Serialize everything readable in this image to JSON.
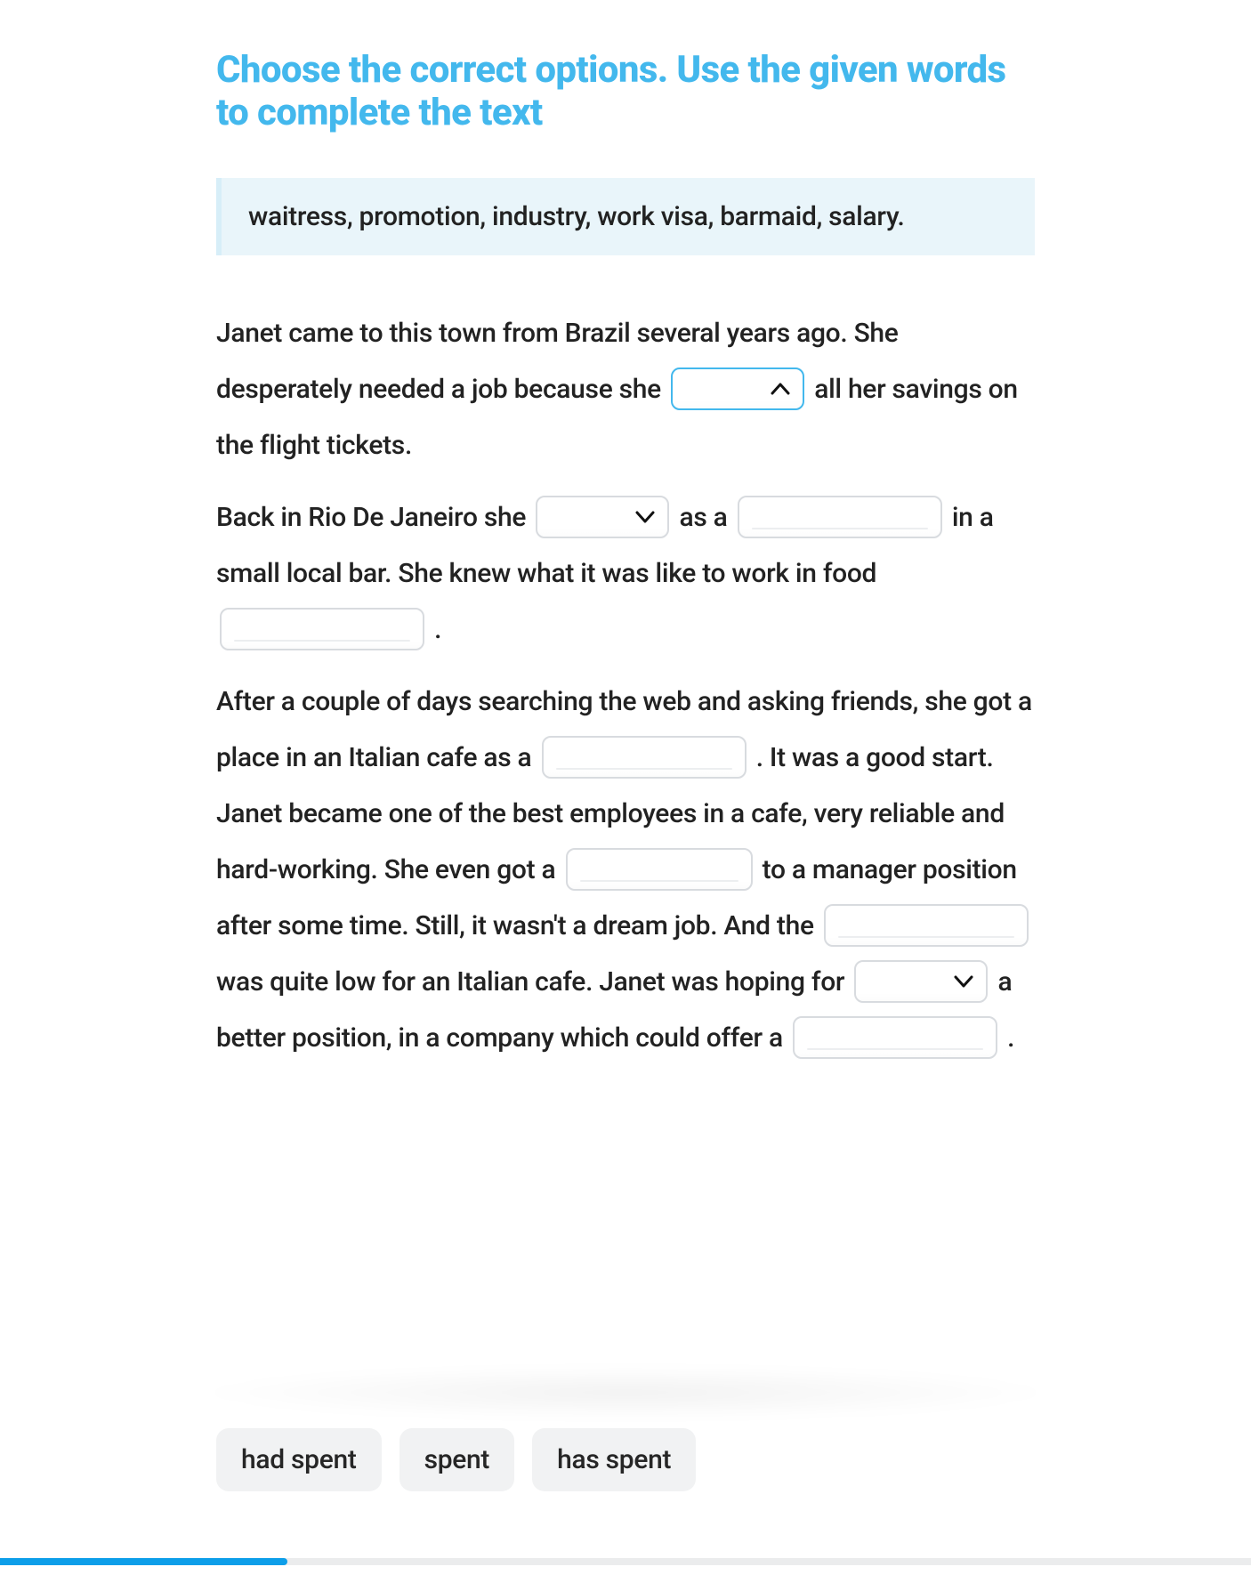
{
  "title": "Choose the correct options. Use the given words to complete the text",
  "wordbank": "waitress, promotion, industry, work visa, barmaid, salary.",
  "passage": {
    "p1a": "Janet came to this town from Brazil several years ago. She desperately needed a job because she ",
    "p1b": " all her savings on the flight tickets.",
    "p2a": "Back in Rio De Janeiro she ",
    "p2b": " as a ",
    "p2c": " in a small local bar. She knew what it was like to work in food ",
    "p2d": " .",
    "p3a": "After a couple of days searching the web and asking friends, she got a place in an Italian cafe as a ",
    "p3b": ". It was a good start. Janet became one of the best employees in a cafe, very reliable and hard-working. She even got a ",
    "p3c": " to a manager position after some time. Still, it wasn't a dream job. And the ",
    "p3d": " was quite low for an Italian cafe. Janet was hoping for ",
    "p3e": " a better position, in a company which could offer a ",
    "p3f": "."
  },
  "selects": {
    "s1": {
      "open": true
    },
    "s2": {
      "open": false
    },
    "s3": {
      "open": false
    }
  },
  "answer_options": [
    "had spent",
    "spent",
    "has spent"
  ],
  "progress_percent": 23
}
